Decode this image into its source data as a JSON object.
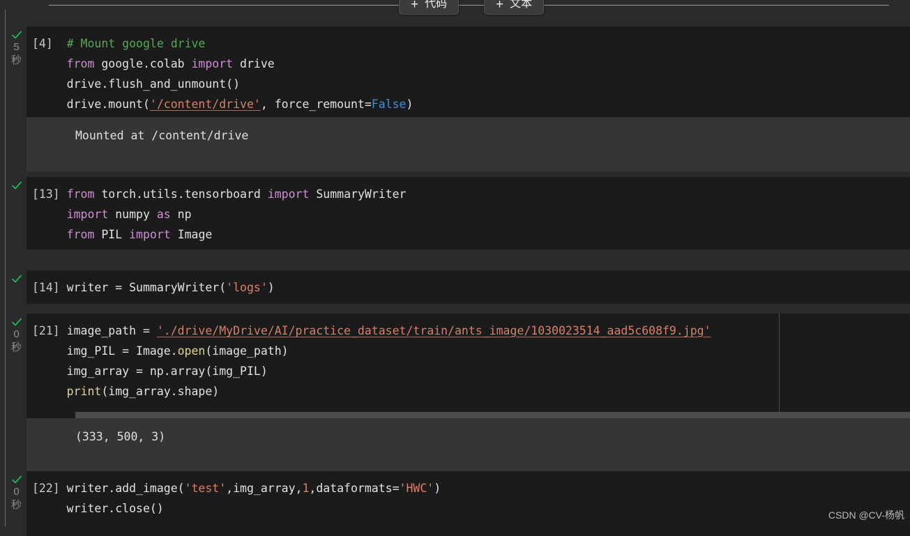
{
  "toolbar": {
    "add_code_label": "代码",
    "add_text_label": "文本",
    "plus_glyph": "+"
  },
  "watermark": "CSDN @CV-杨帆",
  "colors": {
    "page_bg": "#2b2b2b",
    "code_bg": "#1b1b1b",
    "output_bg": "#353535",
    "check_green": "#21b35a",
    "keyword": "#d08ed6",
    "comment": "#54a954",
    "string": "#d8806b",
    "builtin": "#e0d694",
    "constant": "#3a91e0"
  },
  "cells": [
    {
      "id": "cell-4",
      "label": "[4]",
      "status": "success",
      "runtime_value": "5",
      "runtime_unit": "秒",
      "code_lines": [
        "# Mount google drive",
        "from google.colab import drive",
        "drive.flush_and_unmount()",
        "drive.mount('/content/drive', force_remount=False)"
      ],
      "output": "Mounted at /content/drive"
    },
    {
      "id": "cell-13",
      "label": "[13]",
      "status": "success",
      "runtime_value": "",
      "runtime_unit": "",
      "code_lines": [
        "from torch.utils.tensorboard import SummaryWriter",
        "import numpy as np",
        "from PIL import Image"
      ],
      "output": ""
    },
    {
      "id": "cell-14",
      "label": "[14]",
      "status": "success",
      "runtime_value": "",
      "runtime_unit": "",
      "code_lines": [
        "writer = SummaryWriter('logs')"
      ],
      "output": ""
    },
    {
      "id": "cell-21",
      "label": "[21]",
      "status": "success",
      "runtime_value": "0",
      "runtime_unit": "秒",
      "code_lines": [
        "image_path = './drive/MyDrive/AI/practice_dataset/train/ants_image/1030023514_aad5c608f9.jpg'",
        "img_PIL = Image.open(image_path)",
        "img_array = np.array(img_PIL)",
        "print(img_array.shape)"
      ],
      "output": "(333, 500, 3)"
    },
    {
      "id": "cell-22",
      "label": "[22]",
      "status": "success",
      "runtime_value": "0",
      "runtime_unit": "秒",
      "code_lines": [
        "writer.add_image('test',img_array,1,dataformats='HWC')",
        "writer.close()"
      ],
      "output": ""
    }
  ]
}
